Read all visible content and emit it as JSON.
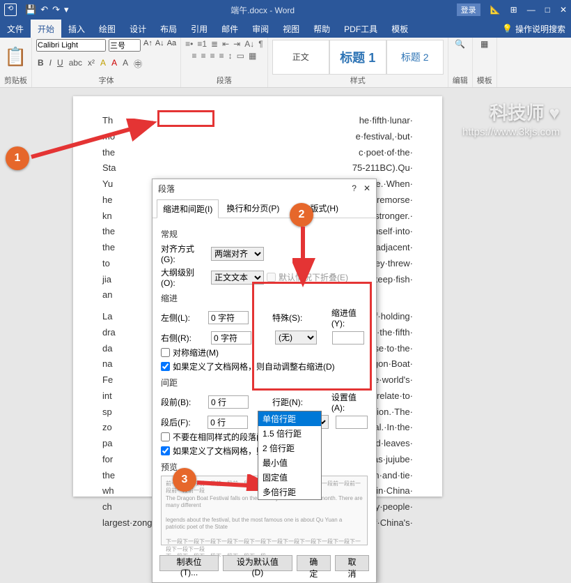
{
  "title": {
    "filename": "端午.docx",
    "app": "Word",
    "signin": "登录"
  },
  "tabs": {
    "file": "文件",
    "home": "开始",
    "insert": "插入",
    "draw": "绘图",
    "design": "设计",
    "layout": "布局",
    "references": "引用",
    "mailings": "邮件",
    "review": "审阅",
    "view": "视图",
    "help": "帮助",
    "pdf": "PDF工具",
    "template": "模板",
    "tellme": "操作说明搜索"
  },
  "ribbon": {
    "clipboard": {
      "label": "剪贴板",
      "paste": "粘贴"
    },
    "font": {
      "label": "字体",
      "family": "Calibri Light",
      "size": "三号"
    },
    "paragraph": {
      "label": "段落"
    },
    "styles": {
      "label": "样式",
      "normal": "正文",
      "h1": "标题 1",
      "h2": "标题 2"
    },
    "editing": {
      "label": "编辑"
    },
    "templates": {
      "label": "模板"
    }
  },
  "doc": {
    "left1": "Th\nmo\nthe\nSta\nYu\nhe\nkn\nthe\nthe\nto\njia\nan",
    "right1": "he·fifth·lunar·\ne·festival,·but·\nc·poet·of·the·\n75-211BC).Qu·\nble·life.·When·\n,·his·remorse·\nand·stronger.·\nv·himself·into·\niving·adjacent·\nn.·They·threw·\nr·to·keep·fish·",
    "left2": "La\ndra\nda\nna\nFe\nint\nsp\nzo\npa\nfor\nthe\nwh\nch\nlargest·zongzi·producers.",
    "right2": "ms·of·holding·\ner·on·the·fifth·\ng·rise·to·the·\n·Dragon·Boat·\nor·the·world's·\n·are·relate·to·\nxception.·The·\nestival.·In·the·\n·reed·leaves·\nich·as·jujube·\n·ham·and·tie·\npular·in·China·\nMany·people·\n·of·China's·"
  },
  "dialog": {
    "title": "段落",
    "tabs": {
      "indent": "缩进和间距(I)",
      "linebreak": "换行和分页(P)",
      "asian": "中文版式(H)"
    },
    "general": "常规",
    "align": {
      "label": "对齐方式(G):",
      "value": "两端对齐"
    },
    "outline": {
      "label": "大纲级别(O):",
      "value": "正文文本"
    },
    "collapse": "默认情况下折叠(E)",
    "indent": "缩进",
    "left": {
      "label": "左侧(L):",
      "value": "0 字符"
    },
    "right": {
      "label": "右侧(R):",
      "value": "0 字符"
    },
    "special": {
      "label": "特殊(S):",
      "value": "(无)"
    },
    "by": {
      "label": "缩进值(Y):",
      "value": ""
    },
    "mirror": "对称缩进(M)",
    "grid1": "如果定义了文档网格，则自动调整右缩进(D)",
    "spacing": "间距",
    "before": {
      "label": "段前(B):",
      "value": "0 行"
    },
    "after": {
      "label": "段后(F):",
      "value": "0 行"
    },
    "line": {
      "label": "行距(N):",
      "value": "2 倍行距"
    },
    "at": {
      "label": "设置值(A):",
      "value": ""
    },
    "nospace": "不要在相同样式的段落间增加间距",
    "grid2": "如果定义了文档网格，则对齐到网格",
    "preview": "预览",
    "tabs_btn": "制表位(T)...",
    "default_btn": "设为默认值(D)",
    "ok": "确定",
    "cancel": "取消"
  },
  "dropdown": {
    "items": [
      "单倍行距",
      "1.5 倍行距",
      "2 倍行距",
      "最小值",
      "固定值",
      "多倍行距"
    ],
    "selected": 0
  },
  "badges": {
    "b1": "1",
    "b2": "2",
    "b3": "3"
  },
  "watermark": {
    "brand": "科技师 ♥",
    "url": "https://www.3kjs.com"
  },
  "chart_data": null
}
